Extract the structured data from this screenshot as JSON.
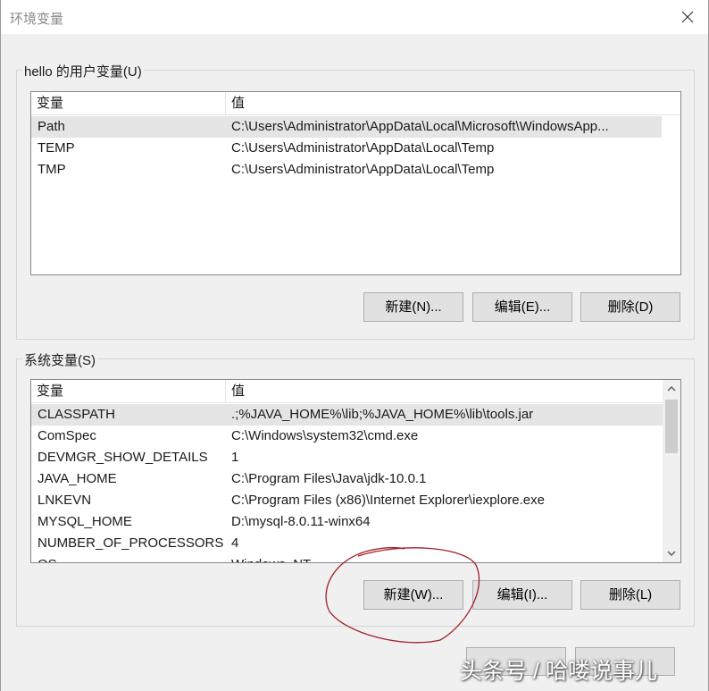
{
  "window": {
    "title": "环境变量"
  },
  "user_vars": {
    "group_label": "hello 的用户变量(U)",
    "col_name": "变量",
    "col_value": "值",
    "rows": [
      {
        "name": "Path",
        "value": "C:\\Users\\Administrator\\AppData\\Local\\Microsoft\\WindowsApp..."
      },
      {
        "name": "TEMP",
        "value": "C:\\Users\\Administrator\\AppData\\Local\\Temp"
      },
      {
        "name": "TMP",
        "value": "C:\\Users\\Administrator\\AppData\\Local\\Temp"
      }
    ],
    "buttons": {
      "new": "新建(N)...",
      "edit": "编辑(E)...",
      "delete": "删除(D)"
    }
  },
  "system_vars": {
    "group_label": "系统变量(S)",
    "col_name": "变量",
    "col_value": "值",
    "rows": [
      {
        "name": "CLASSPATH",
        "value": ".;%JAVA_HOME%\\lib;%JAVA_HOME%\\lib\\tools.jar"
      },
      {
        "name": "ComSpec",
        "value": "C:\\Windows\\system32\\cmd.exe"
      },
      {
        "name": "DEVMGR_SHOW_DETAILS",
        "value": "1"
      },
      {
        "name": "JAVA_HOME",
        "value": "C:\\Program Files\\Java\\jdk-10.0.1"
      },
      {
        "name": "LNKEVN",
        "value": "C:\\Program Files (x86)\\Internet Explorer\\iexplore.exe"
      },
      {
        "name": "MYSQL_HOME",
        "value": "D:\\mysql-8.0.11-winx64"
      },
      {
        "name": "NUMBER_OF_PROCESSORS",
        "value": "4"
      },
      {
        "name": "OS",
        "value": "Windows_NT"
      }
    ],
    "buttons": {
      "new": "新建(W)...",
      "edit": "编辑(I)...",
      "delete": "删除(L)"
    }
  },
  "watermark": "头条号 / 哈喽说事儿",
  "colors": {
    "annotation": "#a0202a",
    "selected_row": "#e5e5e5",
    "button_face": "#e1e1e1"
  }
}
